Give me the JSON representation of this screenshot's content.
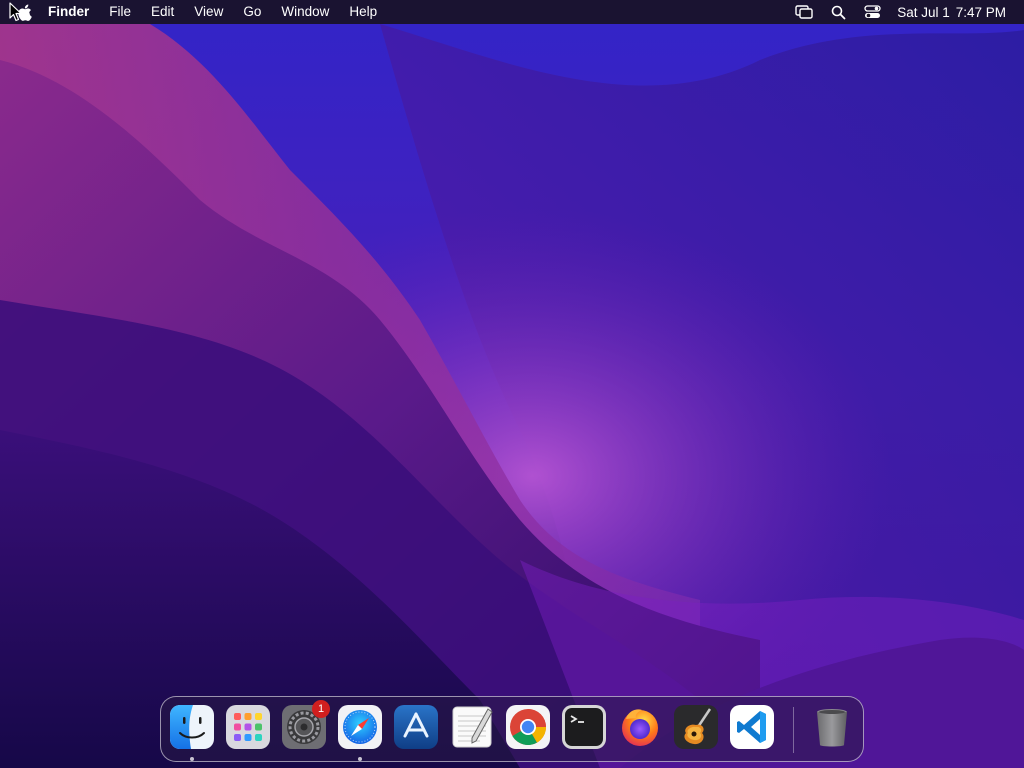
{
  "menubar": {
    "app_name": "Finder",
    "menus": [
      "File",
      "Edit",
      "View",
      "Go",
      "Window",
      "Help"
    ],
    "status_icons": [
      "screen-mirroring-icon",
      "spotlight-search-icon",
      "control-center-icon"
    ],
    "clock": {
      "date": "Sat Jul 1",
      "time": "7:47 PM"
    }
  },
  "dock": {
    "apps": [
      {
        "name": "Finder",
        "icon": "finder-icon",
        "running": true
      },
      {
        "name": "Launchpad",
        "icon": "launchpad-icon",
        "running": false
      },
      {
        "name": "System Settings",
        "icon": "system-settings-icon",
        "running": false,
        "badge": "1"
      },
      {
        "name": "Safari",
        "icon": "safari-icon",
        "running": true
      },
      {
        "name": "App Store",
        "icon": "app-store-icon",
        "running": false
      },
      {
        "name": "TextEdit",
        "icon": "textedit-icon",
        "running": false
      },
      {
        "name": "Google Chrome",
        "icon": "chrome-icon",
        "running": false
      },
      {
        "name": "Terminal",
        "icon": "terminal-icon",
        "running": false
      },
      {
        "name": "Firefox",
        "icon": "firefox-icon",
        "running": false
      },
      {
        "name": "GarageBand",
        "icon": "garageband-icon",
        "running": false
      },
      {
        "name": "Visual Studio Code",
        "icon": "vscode-icon",
        "running": false
      },
      {
        "name": "Trash",
        "icon": "trash-icon",
        "running": false
      }
    ]
  },
  "colors": {
    "wallpaper_top": "#3b2bd4",
    "wallpaper_mid": "#6a1fb0",
    "wallpaper_dark": "#1e0b55",
    "accent_pink": "#c0307a"
  }
}
